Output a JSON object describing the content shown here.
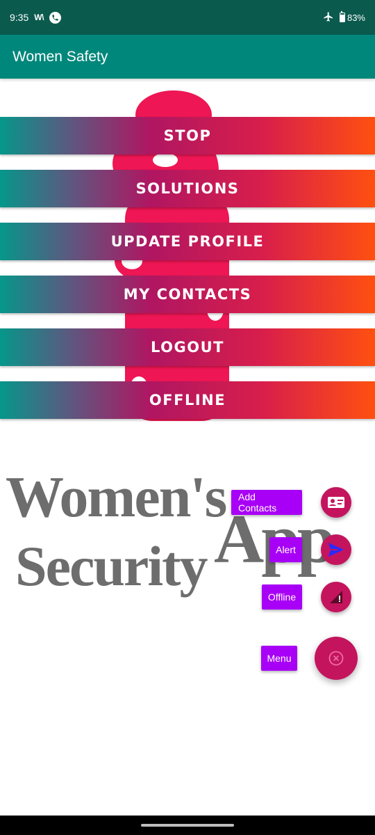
{
  "status_bar": {
    "time": "9:35",
    "wifi_calling": "W\\",
    "battery": "83%",
    "icons": [
      "wifi-calling-icon",
      "phone-icon",
      "airplane-icon",
      "battery-icon"
    ]
  },
  "app_bar": {
    "title": "Women Safety"
  },
  "menu": {
    "items": [
      {
        "label": "STOP"
      },
      {
        "label": "SOLUTIONS"
      },
      {
        "label": "UPDATE PROFILE"
      },
      {
        "label": "MY CONTACTS"
      },
      {
        "label": "LOGOUT"
      },
      {
        "label": "OFFLINE"
      }
    ]
  },
  "logo": {
    "line1": "Women's",
    "line2": "Security",
    "line3": "App"
  },
  "fab_menu": {
    "items": [
      {
        "label": "Add Contacts",
        "icon": "contact-card-icon"
      },
      {
        "label": "Alert",
        "icon": "send-icon"
      },
      {
        "label": "Offline",
        "icon": "signal-off-icon"
      }
    ],
    "main": {
      "label": "Menu",
      "icon": "close-circle-icon"
    }
  },
  "colors": {
    "status_bar": "#0b5a4e",
    "app_bar": "#00877b",
    "gradient_start": "#05978a",
    "gradient_mid": "#b01662",
    "gradient_end": "#ff5010",
    "fab": "#c4145e",
    "fab_label": "#a800f6",
    "figure": "#ee1654"
  }
}
